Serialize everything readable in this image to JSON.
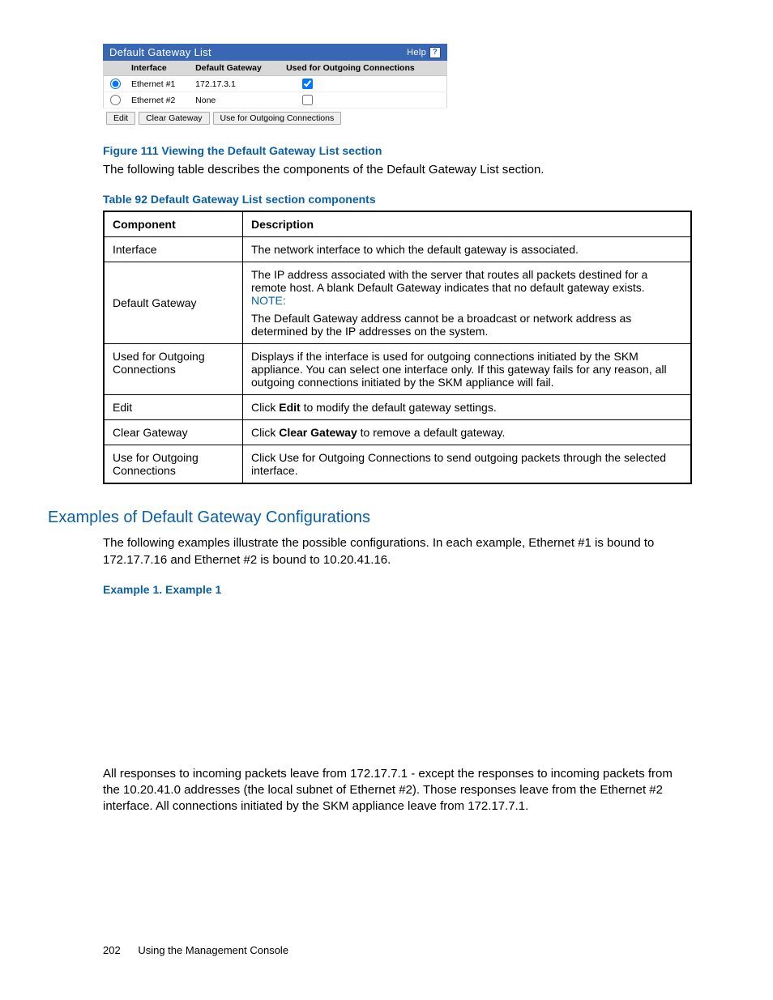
{
  "gateway_list": {
    "title": "Default Gateway List",
    "help_label": "Help",
    "headers": {
      "interface": "Interface",
      "gateway": "Default Gateway",
      "used": "Used for Outgoing Connections"
    },
    "rows": [
      {
        "selected": true,
        "interface": "Ethernet #1",
        "gateway": "172.17.3.1",
        "outgoing": true
      },
      {
        "selected": false,
        "interface": "Ethernet #2",
        "gateway": "None",
        "outgoing": false
      }
    ],
    "buttons": {
      "edit": "Edit",
      "clear": "Clear Gateway",
      "use": "Use for Outgoing Connections"
    }
  },
  "figure_caption": "Figure 111 Viewing the Default Gateway List section",
  "intro_text": "The following table describes the components of the Default Gateway List section.",
  "table_caption": "Table 92 Default Gateway List section components",
  "comp_headers": {
    "component": "Component",
    "description": "Description"
  },
  "components": {
    "r0": {
      "name": "Interface",
      "desc": "The network interface to which the default gateway is associated."
    },
    "r1": {
      "name": "Default Gateway",
      "desc1": "The IP address associated with the server that routes all packets destined for a remote host. A blank Default Gateway indicates that no default gateway exists.",
      "note": "NOTE:",
      "desc2": "The Default Gateway address cannot be a broadcast or network address as determined by the IP addresses on the system."
    },
    "r2": {
      "name": "Used for Outgoing Connections",
      "desc": "Displays if the interface is used for outgoing connections initiated by the SKM appliance. You can select one interface only. If this gateway fails for any reason, all outgoing connections initiated by the SKM appliance will fail."
    },
    "r3": {
      "name": "Edit",
      "pre": "Click ",
      "bold": "Edit",
      "post": " to modify the default gateway settings."
    },
    "r4": {
      "name": "Clear Gateway",
      "pre": "Click ",
      "bold": "Clear Gateway",
      "post": " to remove a default gateway."
    },
    "r5": {
      "name": "Use for Outgoing Connections",
      "desc": "Click Use for Outgoing Connections to send outgoing packets through the selected interface."
    }
  },
  "section_heading": "Examples of Default Gateway Configurations",
  "examples_intro": "The following examples illustrate the possible configurations. In each example, Ethernet #1 is bound to 172.17.7.16 and Ethernet #2 is bound to 10.20.41.16.",
  "example_caption": "Example 1. Example 1",
  "example_body": "All responses to incoming packets leave from 172.17.7.1 - except the responses to incoming packets from the 10.20.41.0 addresses (the local subnet of Ethernet #2). Those responses leave from the Ethernet #2 interface. All connections initiated by the SKM appliance leave from 172.17.7.1.",
  "footer": {
    "page": "202",
    "title": "Using the Management Console"
  }
}
